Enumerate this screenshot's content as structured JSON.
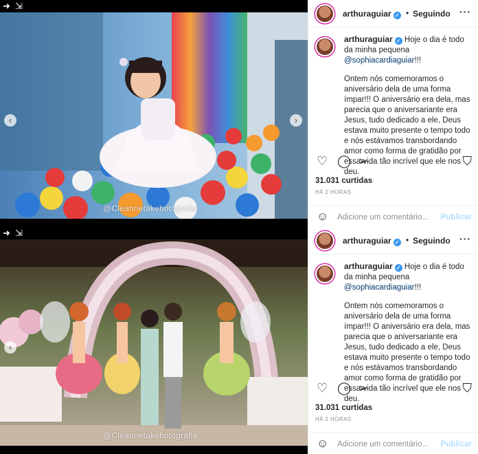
{
  "posts": [
    {
      "watermark": "@Cleannetakehotografia",
      "header": {
        "username": "arthuraguiar",
        "follow_label": "Seguindo"
      },
      "caption": {
        "username": "arthuraguiar",
        "lead": "Hoje o dia é todo da minha pequena",
        "mention": "@sophiacardiaguiar",
        "lead_end": "!!!",
        "body": "Ontem nós comemoramos o aniversário dela de uma forma ímpar!!! O aniversário era dela, mas parecia que o aniversariante era Jesus, tudo dedicado a ele, Deus estava muito presente o tempo todo e nós estávamos transbordando amor como forma de gratidão por essa vida tão incrível que ele nos deu."
      },
      "likes": "31.031 curtidas",
      "time": "HÁ 2 HORAS",
      "comment_placeholder": "Adicione um comentário...",
      "publish_label": "Publicar"
    },
    {
      "watermark": "@Cleannetakehotografia",
      "header": {
        "username": "arthuraguiar",
        "follow_label": "Seguindo"
      },
      "caption": {
        "username": "arthuraguiar",
        "lead": "Hoje o dia é todo da minha pequena",
        "mention": "@sophiacardiaguiar",
        "lead_end": "!!!",
        "body": "Ontem nós comemoramos o aniversário dela de uma forma ímpar!!! O aniversário era dela, mas parecia que o aniversariante era Jesus, tudo dedicado a ele, Deus estava muito presente o tempo todo e nós estávamos transbordando amor como forma de gratidão por essa vida tão incrível que ele nos deu."
      },
      "likes": "31.031 curtidas",
      "time": "HÁ 2 HORAS",
      "comment_placeholder": "Adicione um comentário...",
      "publish_label": "Publicar"
    }
  ],
  "icons": {
    "heart": "heart-icon",
    "comment": "comment-icon",
    "share": "send-icon",
    "save": "bookmark-icon",
    "more": "more-options-icon",
    "emoji": "emoji-icon",
    "verified": "verified-badge-icon"
  },
  "colors": {
    "verified": "#3897f0",
    "mention": "#00376b",
    "publish": "#b2dffc"
  }
}
